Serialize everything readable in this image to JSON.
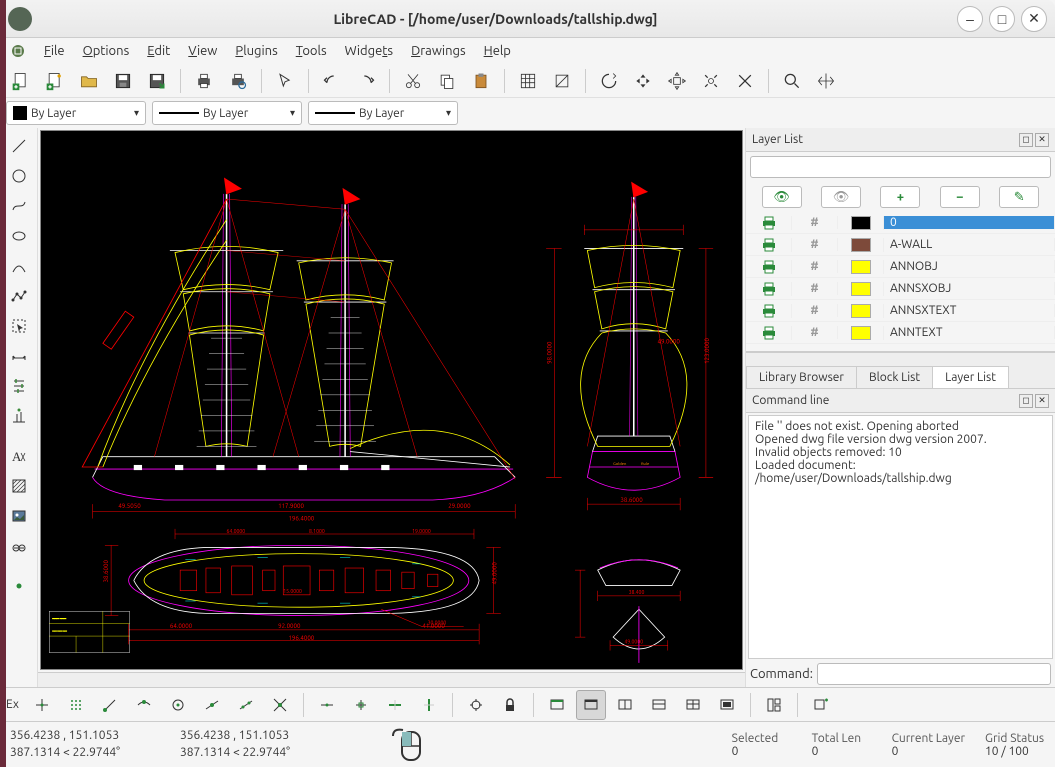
{
  "titlebar": {
    "title": "LibreCAD - [/home/user/Downloads/tallship.dwg]"
  },
  "menu": {
    "file": "File",
    "options": "Options",
    "edit": "Edit",
    "view": "View",
    "plugins": "Plugins",
    "tools": "Tools",
    "widgets": "Widgets",
    "drawings": "Drawings",
    "help": "Help"
  },
  "dropdowns": {
    "color_label": "By Layer",
    "width_label": "By Layer",
    "line_label": "By Layer"
  },
  "panels": {
    "layer_list": "Layer List",
    "library_browser": "Library Browser",
    "block_list": "Block List",
    "layer_list_tab": "Layer List",
    "command_line": "Command line",
    "command_label": "Command:"
  },
  "layers": [
    {
      "print": "print",
      "hash": "#",
      "color": "#000000",
      "name": "0",
      "active": true
    },
    {
      "print": "print",
      "hash": "#",
      "color": "#7d4a3a",
      "name": "A-WALL",
      "active": false
    },
    {
      "print": "print",
      "hash": "#",
      "color": "#ffff00",
      "name": "ANNOBJ",
      "active": false
    },
    {
      "print": "print",
      "hash": "#",
      "color": "#ffff00",
      "name": "ANNSXOBJ",
      "active": false
    },
    {
      "print": "print",
      "hash": "#",
      "color": "#ffff00",
      "name": "ANNSXTEXT",
      "active": false
    },
    {
      "print": "print",
      "hash": "#",
      "color": "#ffff00",
      "name": "ANNTEXT",
      "active": false
    }
  ],
  "cmd_output": "File '' does not exist. Opening aborted\nOpened dwg file version dwg version 2007.\nInvalid objects removed: 10\nLoaded document: /home/user/Downloads/tallship.dwg",
  "status": {
    "abs_coord": "356.4238 , 151.1053",
    "polar_coord": "387.1314 < 22.9744°",
    "rel_coord": "356.4238 , 151.1053",
    "rel_polar": "387.1314 < 22.9744°",
    "selected_label": "Selected",
    "selected_val": "0",
    "total_len_label": "Total Len",
    "total_len_val": "0",
    "current_layer_label": "Current Layer",
    "current_layer_val": "0",
    "grid_label": "Grid Status",
    "grid_val": "10 / 100"
  },
  "bottom": {
    "ex": "Ex"
  }
}
